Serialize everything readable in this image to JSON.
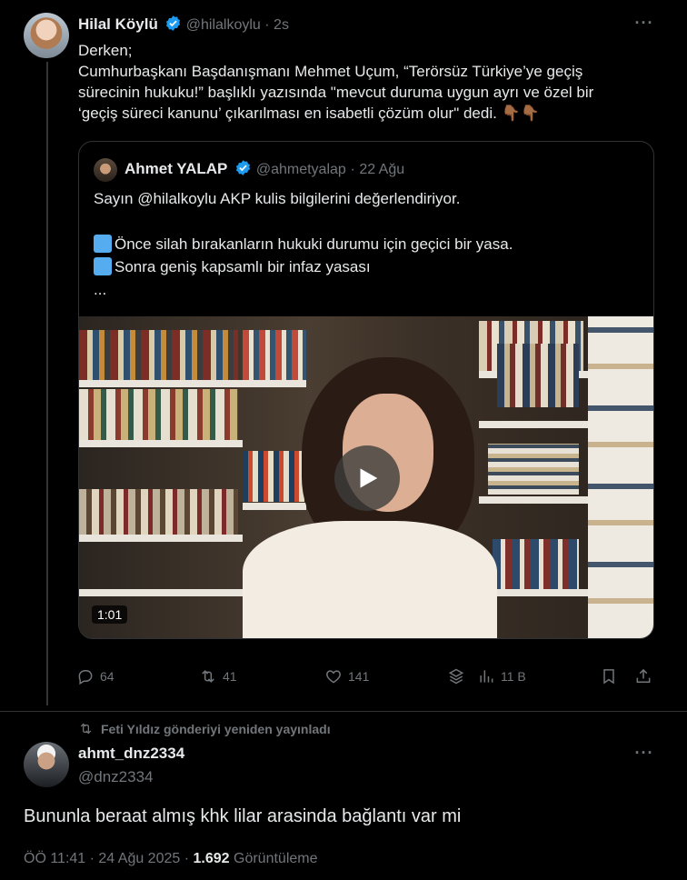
{
  "tweet": {
    "author_name": "Hilal Köylü",
    "author_handle": "@hilalkoylu",
    "time": "· 2s",
    "more": "···",
    "lines": [
      "Derken;",
      "Cumhurbaşkanı Başdanışmanı Mehmet Uçum, “Terörsüz Türkiye’ye geçiş",
      "sürecinin hukuku!” başlıklı yazısında \"mevcut duruma uygun ayrı ve özel bir",
      "‘geçiş süreci kanunu’ çıkarılması en isabetli çözüm olur\" dedi. 👇🏾👇🏾"
    ]
  },
  "quote": {
    "author_name": "Ahmet YALAP",
    "author_handle": "@ahmetyalap",
    "date": "· 22 Ağu",
    "line1": "Sayın @hilalkoylu AKP kulis bilgilerini değerlendiriyor.",
    "line2": "Önce silah bırakanların hukuki durumu için geçici bir yasa.",
    "line3": "Sonra geniş kapsamlı bir infaz yasası",
    "line4": "...",
    "video_duration": "1:01"
  },
  "actions": {
    "replies": "64",
    "reposts": "41",
    "likes": "141",
    "views": "11 B"
  },
  "reply": {
    "repost_note": "Feti Yıldız gönderiyi yeniden yayınladı",
    "author_name": "ahmt_dnz2334",
    "author_handle": "@dnz2334",
    "more": "···",
    "text": "Bununla beraat almış khk lilar arasinda bağlantı var mi",
    "time": "ÖÖ 11:41 · 24 Ağu 2025 ·",
    "views_count": "1.692",
    "views_label": "Görüntüleme"
  },
  "colors": {
    "background": "#000000",
    "text": "#e7e9ea",
    "muted": "#71767b",
    "border": "#2f3336",
    "verified": "#1d9bf0"
  }
}
